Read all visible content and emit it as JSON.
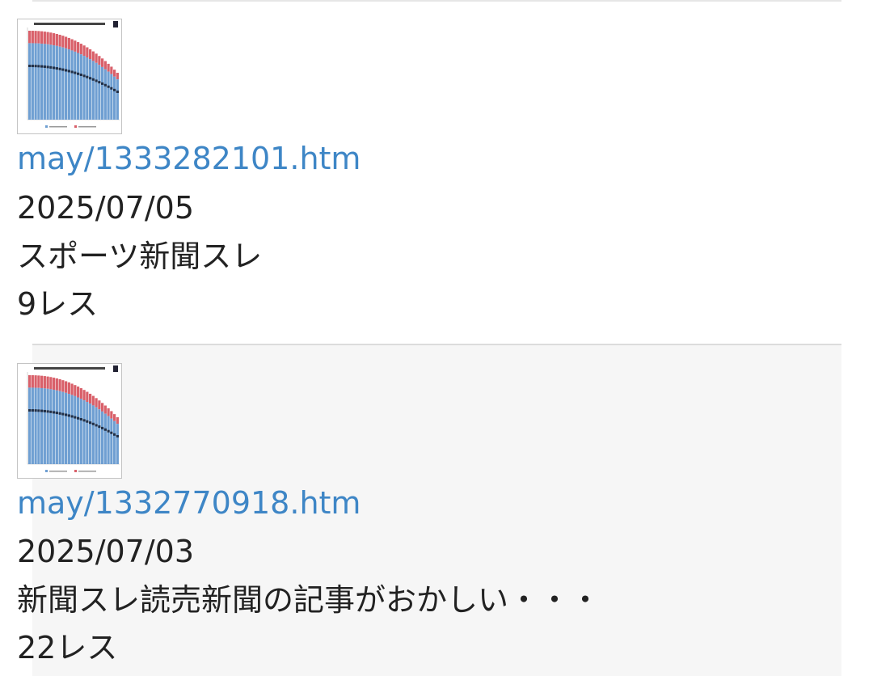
{
  "entries": [
    {
      "link": "may/1333282101.htm",
      "date": "2025/07/05",
      "title": "スポーツ新聞スレ",
      "count": "9レス",
      "thumbnail_icon": "newspaper-circulation-chart-thumbnail"
    },
    {
      "link": "may/1332770918.htm",
      "date": "2025/07/03",
      "title": "新聞スレ読売新聞の記事がおかしい・・・",
      "count": "22レス",
      "thumbnail_icon": "newspaper-circulation-chart-thumbnail"
    }
  ],
  "colors": {
    "link": "#3e86c6",
    "text": "#222222",
    "alt_row_bg": "#f6f6f6",
    "chart_blue": "#6f9fd2",
    "chart_red": "#d9606a",
    "chart_dark": "#1f2f48"
  }
}
